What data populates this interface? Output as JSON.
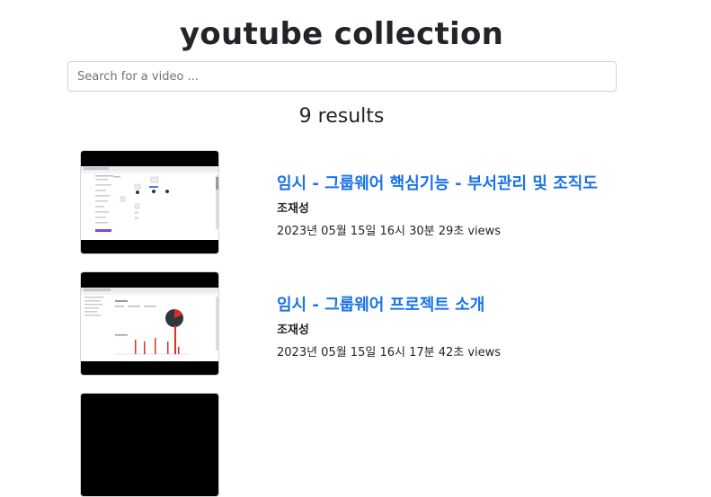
{
  "page": {
    "title": "youtube collection",
    "search_placeholder": "Search for a video ...",
    "search_value": "",
    "results_count": "9 results"
  },
  "videos": [
    {
      "title": "임시 - 그룹웨어 핵심기능 - 부서관리 및 조직도",
      "author": "조재성",
      "meta": "2023년 05월 15일 16시 30분 29초 views"
    },
    {
      "title": "임시 - 그룹웨어 프로젝트 소개",
      "author": "조재성",
      "meta": "2023년 05월 15일 16시 17분 42초 views"
    }
  ]
}
